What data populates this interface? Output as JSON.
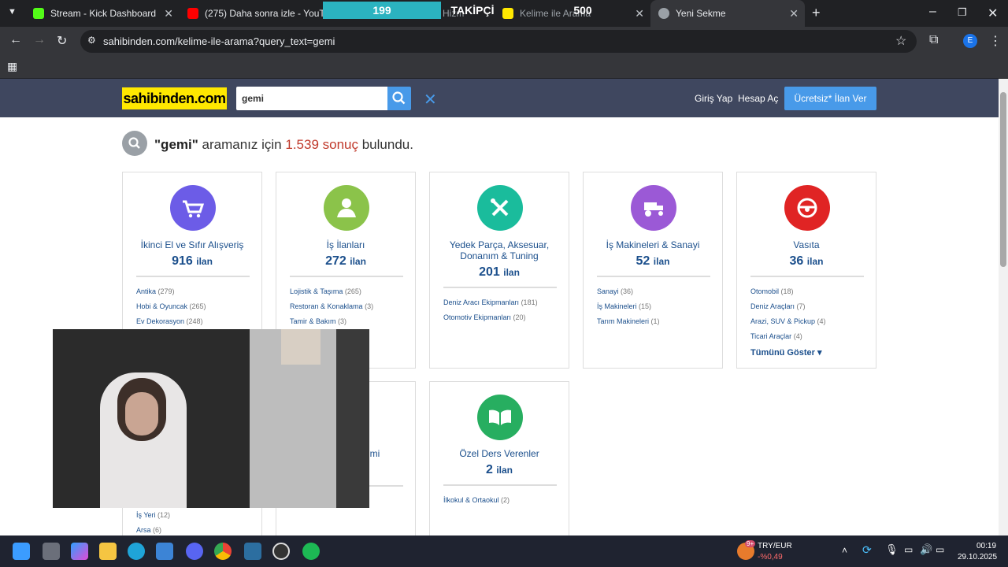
{
  "browser": {
    "tabs": [
      {
        "title": "Stream - Kick Dashboard",
        "active": false
      },
      {
        "title": "(275) Daha sonra izle - YouTube",
        "active": false
      },
      {
        "title": "Hizm",
        "active": false
      },
      {
        "title": "Kelime ile Arama",
        "active": false
      },
      {
        "title": "Yeni Sekme",
        "active": true
      }
    ],
    "url": "sahibinden.com/kelime-ile-arama?query_text=gemi",
    "profile_initial": "E"
  },
  "stream_overlay": {
    "count_left": "199",
    "label": "TAKİPÇİ",
    "count_right": "500"
  },
  "header": {
    "logo": "sahibinden.com",
    "search_value": "gemi",
    "login": "Giriş Yap",
    "register": "Hesap Aç",
    "post_ad": "Ücretsiz* İlan Ver"
  },
  "results": {
    "query": "\"gemi\"",
    "middle": " aramanız için ",
    "count": "1.539 sonuç",
    "suffix": " bulundu."
  },
  "unit": "ilan",
  "categories": [
    {
      "name": "İkinci El ve Sıfır Alışveriş",
      "count": "916",
      "color": "#6c5ce7",
      "subs": [
        {
          "name": "Antika",
          "n": "(279)"
        },
        {
          "name": "Hobi & Oyuncak",
          "n": "(265)"
        },
        {
          "name": "Ev Dekorasyon",
          "n": "(248)"
        }
      ]
    },
    {
      "name": "İş İlanları",
      "count": "272",
      "color": "#8bc34a",
      "subs": [
        {
          "name": "Lojistik & Taşıma",
          "n": "(265)"
        },
        {
          "name": "Restoran & Konaklama",
          "n": "(3)"
        },
        {
          "name": "Tamir & Bakım",
          "n": "(3)"
        }
      ]
    },
    {
      "name": "Yedek Parça, Aksesuar,",
      "name2": "Donanım & Tuning",
      "count": "201",
      "color": "#1abc9c",
      "subs": [
        {
          "name": "Deniz Aracı Ekipmanları",
          "n": "(181)"
        },
        {
          "name": "Otomotiv Ekipmanları",
          "n": "(20)"
        }
      ]
    },
    {
      "name": "İş Makineleri & Sanayi",
      "count": "52",
      "color": "#9b59d6",
      "subs": [
        {
          "name": "Sanayi",
          "n": "(36)"
        },
        {
          "name": "İş Makineleri",
          "n": "(15)"
        },
        {
          "name": "Tarım Makineleri",
          "n": "(1)"
        }
      ]
    },
    {
      "name": "Vasıta",
      "count": "36",
      "color": "#e02424",
      "subs": [
        {
          "name": "Otomobil",
          "n": "(18)"
        },
        {
          "name": "Deniz Araçları",
          "n": "(7)"
        },
        {
          "name": "Arazi, SUV & Pickup",
          "n": "(4)"
        },
        {
          "name": "Ticari Araçlar",
          "n": "(4)"
        }
      ],
      "show_all": "Tümünü Göster"
    },
    {
      "name": "Özel Ders Verenler",
      "count": "2",
      "color": "#27ae60",
      "subs": [
        {
          "name": "İlkokul & Ortaokul",
          "n": "(2)"
        }
      ]
    }
  ],
  "partial": {
    "emlak_label_fragment": "mi",
    "emlak_subs": [
      {
        "name": "İş Yeri",
        "n": "(12)"
      },
      {
        "name": "Arsa",
        "n": "(6)"
      }
    ]
  },
  "taskbar": {
    "currency_pair": "TRY/EUR",
    "currency_change": "-%0,49",
    "badge": "9+",
    "time": "00:19",
    "date": "29.10.2025"
  }
}
